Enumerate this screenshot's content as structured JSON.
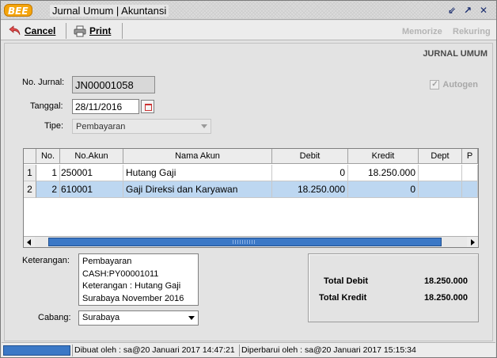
{
  "window": {
    "logo": "BEE",
    "title": "Jurnal Umum | Akuntansi"
  },
  "toolbar": {
    "cancel_label": "Cancel",
    "print_label": "Print",
    "memorize_label": "Memorize",
    "rekuring_label": "Rekuring"
  },
  "form": {
    "header": "JURNAL UMUM",
    "no_jurnal_label": "No. Jurnal:",
    "no_jurnal_value": "JN00001058",
    "tanggal_label": "Tanggal:",
    "tanggal_value": "28/11/2016",
    "tipe_label": "Tipe:",
    "tipe_value": "Pembayaran",
    "autogen_label": "Autogen",
    "autogen_checked": true
  },
  "grid": {
    "columns": [
      "No.",
      "No.Akun",
      "Nama Akun",
      "Debit",
      "Kredit",
      "Dept",
      "P"
    ],
    "rows": [
      {
        "rownum": "1",
        "no": "1",
        "akun": "250001",
        "nama": "Hutang Gaji",
        "debit": "0",
        "kredit": "18.250.000",
        "dept": "",
        "p": ""
      },
      {
        "rownum": "2",
        "no": "2",
        "akun": "610001",
        "nama": "Gaji Direksi dan Karyawan",
        "debit": "18.250.000",
        "kredit": "0",
        "dept": "",
        "p": ""
      }
    ]
  },
  "keterangan": {
    "label": "Keterangan:",
    "lines": [
      "Pembayaran",
      "CASH:PY00001011",
      "Keterangan : Hutang Gaji",
      "Surabaya November 2016"
    ]
  },
  "cabang": {
    "label": "Cabang:",
    "value": "Surabaya"
  },
  "totals": {
    "debit_label": "Total Debit",
    "debit_value": "18.250.000",
    "kredit_label": "Total Kredit",
    "kredit_value": "18.250.000"
  },
  "status": {
    "created": "Dibuat oleh : sa@20 Januari 2017  14:47:21",
    "updated": "Diperbarui oleh : sa@20 Januari 2017  15:15:34"
  },
  "colors": {
    "accent": "#3b78c6",
    "selected_row": "#bdd7f1",
    "logo": "#f4a40b"
  }
}
